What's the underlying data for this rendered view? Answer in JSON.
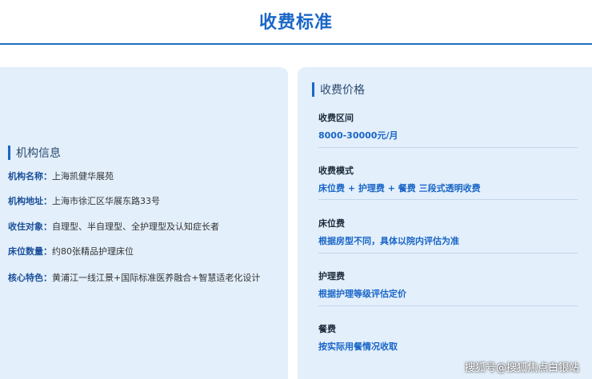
{
  "page": {
    "title": "收费标准"
  },
  "institution": {
    "section_title": "机构信息",
    "rows": [
      {
        "key": "机构名称：",
        "value": "上海凯健华展苑"
      },
      {
        "key": "机构地址：",
        "value": "上海市徐汇区华展东路33号"
      },
      {
        "key": "收住对象：",
        "value": "自理型、半自理型、全护理型及认知症长者"
      },
      {
        "key": "床位数量：",
        "value": "约80张精品护理床位"
      },
      {
        "key": "核心特色：",
        "value": "黄浦江一线江景+国际标准医养融合+智慧适老化设计"
      }
    ]
  },
  "fees": {
    "section_title": "收费价格",
    "items": [
      {
        "label": "收费区间",
        "value": "8000-30000元/月"
      },
      {
        "label": "收费模式",
        "value": "床位费 + 护理费 + 餐费 三段式透明收费"
      },
      {
        "label": "床位费",
        "value": "根据房型不同，具体以院内评估为准"
      },
      {
        "label": "护理费",
        "value": "根据护理等级评估定价"
      },
      {
        "label": "餐费",
        "value": "按实际用餐情况收取"
      }
    ]
  },
  "watermark": "搜狐号@搜狐焦点白银站",
  "colors": {
    "accent": "#1a66c7",
    "panel_bg": "#e3effb",
    "divider": "#c3d6ea"
  }
}
